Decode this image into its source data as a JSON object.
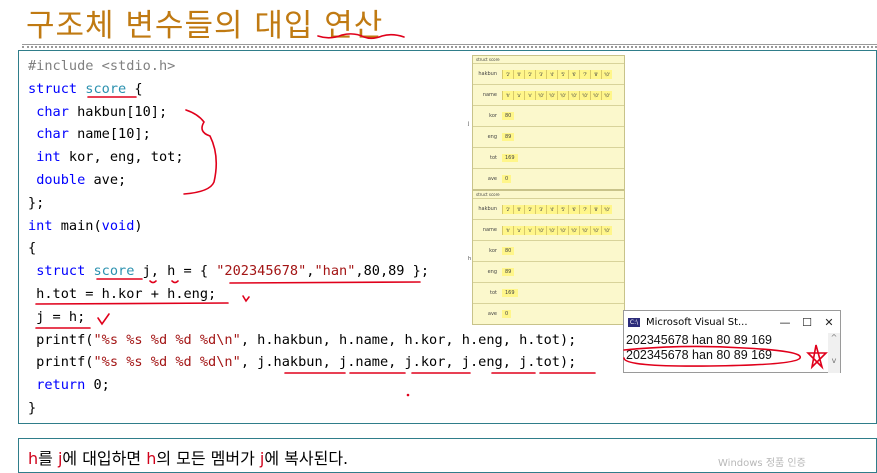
{
  "title": "구조체 변수들의 대입 연산",
  "code_lines": [
    [
      {
        "t": "#include <stdio.h>",
        "c": "pp"
      }
    ],
    [
      {
        "t": "struct",
        "c": "kw"
      },
      {
        "t": " "
      },
      {
        "t": "score",
        "c": "ty"
      },
      {
        "t": " {"
      }
    ],
    [
      {
        "t": " "
      },
      {
        "t": "char",
        "c": "kw"
      },
      {
        "t": " hakbun[10];"
      }
    ],
    [
      {
        "t": " "
      },
      {
        "t": "char",
        "c": "kw"
      },
      {
        "t": " name[10];"
      }
    ],
    [
      {
        "t": " "
      },
      {
        "t": "int",
        "c": "kw"
      },
      {
        "t": " kor, eng, tot;"
      }
    ],
    [
      {
        "t": " "
      },
      {
        "t": "double",
        "c": "kw"
      },
      {
        "t": " ave;"
      }
    ],
    [
      {
        "t": "};"
      }
    ],
    [
      {
        "t": "int",
        "c": "kw"
      },
      {
        "t": " main("
      },
      {
        "t": "void",
        "c": "kw"
      },
      {
        "t": ")"
      }
    ],
    [
      {
        "t": "{"
      }
    ],
    [
      {
        "t": " "
      },
      {
        "t": "struct",
        "c": "kw"
      },
      {
        "t": " "
      },
      {
        "t": "score",
        "c": "ty"
      },
      {
        "t": " j, h = { "
      },
      {
        "t": "\"202345678\"",
        "c": "st"
      },
      {
        "t": ","
      },
      {
        "t": "\"han\"",
        "c": "st"
      },
      {
        "t": ",80,89 };"
      }
    ],
    [
      {
        "t": " h.tot = h.kor + h.eng;"
      }
    ],
    [
      {
        "t": " j = h;"
      }
    ],
    [
      {
        "t": " printf("
      },
      {
        "t": "\"%s %s %d %d %d\\n\"",
        "c": "st"
      },
      {
        "t": ", h.hakbun, h.name, h.kor, h.eng, h.tot);"
      }
    ],
    [
      {
        "t": " printf("
      },
      {
        "t": "\"%s %s %d %d %d\\n\"",
        "c": "st"
      },
      {
        "t": ", j.hakbun, j.name, j.kor, j.eng, j.tot);"
      }
    ],
    [
      {
        "t": " "
      },
      {
        "t": "return",
        "c": "kw"
      },
      {
        "t": " 0;"
      }
    ],
    [
      {
        "t": "}"
      }
    ]
  ],
  "debug_header": "struct score",
  "debug_var_labels": [
    "j",
    "h"
  ],
  "debug_rows": [
    {
      "label": "hakbun",
      "type": "array",
      "cells": [
        "'2'",
        "'0'",
        "'2'",
        "'3'",
        "'4'",
        "'5'",
        "'6'",
        "'7'",
        "'8'",
        "'\\0'"
      ]
    },
    {
      "label": "name",
      "type": "array",
      "cells": [
        "'h'",
        "'a'",
        "'n'",
        "'\\0'",
        "'\\0'",
        "'\\0'",
        "'\\0'",
        "'\\0'",
        "'\\0'",
        "'\\0'"
      ]
    },
    {
      "label": "kor",
      "type": "int",
      "value": "80"
    },
    {
      "label": "eng",
      "type": "int",
      "value": "89"
    },
    {
      "label": "tot",
      "type": "int",
      "value": "169"
    },
    {
      "label": "ave",
      "type": "double",
      "value": "0"
    }
  ],
  "console": {
    "title": "Microsoft Visual St...",
    "icon_text": "C:\\",
    "buttons": {
      "minimize": "—",
      "maximize": "☐",
      "close": "✕"
    },
    "lines": [
      "202345678  han  80  89  169",
      "202345678  han  80  89  169"
    ],
    "scroll_up": "^",
    "scroll_down": "v"
  },
  "note": {
    "h1": "h",
    "t1": "를 ",
    "j1": "j",
    "t2": "에 대입하면 ",
    "h2": "h",
    "t3": "의 모든 멤버가 ",
    "j2": "j",
    "t4": "에 복사된다."
  },
  "watermark": "Windows 정품 인증",
  "colors": {
    "title": "#c07a12",
    "annotation": "#e0001b",
    "panel_border": "#2f7d8a",
    "keyword": "#0000ff",
    "type": "#2b91af",
    "string": "#a31515"
  }
}
